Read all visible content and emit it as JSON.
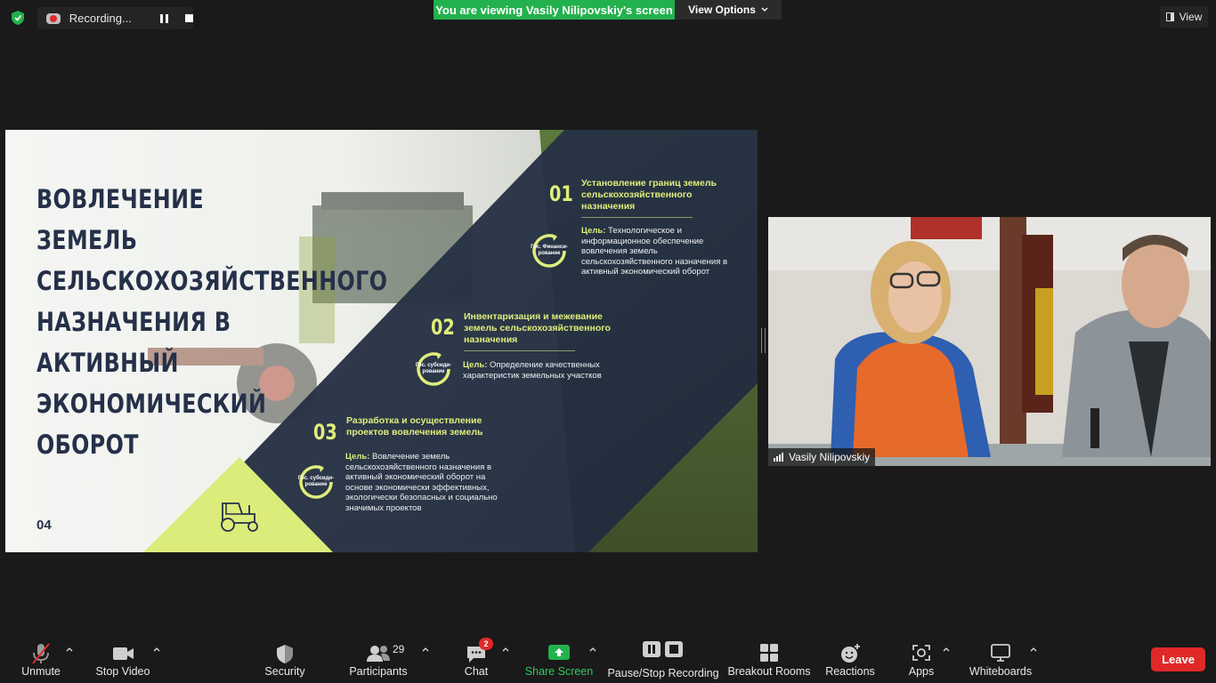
{
  "top_bar": {
    "recording_label": "Recording...",
    "viewing_banner": "You are viewing Vasily Nilipovskiy's screen",
    "view_options_label": "View Options",
    "view_label": "View"
  },
  "slide": {
    "title": "Вовлечение земель сельскохозяйственного назначения в активный экономический оборот",
    "page_number": "04",
    "items": [
      {
        "num": "01",
        "heading": "Установление границ земель сельскохозяйственного назначения",
        "goal_label": "Цель:",
        "goal_text": " Технологическое и информационное обеспечение вовлечения земель сельскохозяйственного назначения в активный экономический оборот",
        "circle_label": "Гос. Финанси-рование"
      },
      {
        "num": "02",
        "heading": "Инвентаризация и межевание земель сельскохозяйственного назначения",
        "goal_label": "Цель:",
        "goal_text": " Определение качественных характеристик земельных участков",
        "circle_label": "Гос. субсиди-рование"
      },
      {
        "num": "03",
        "heading": "Разработка и осуществление проектов вовлечения земель",
        "goal_label": "Цель:",
        "goal_text": " Вовлечение земель сельскохозяйственного назначения в активный экономический оборот на основе экономически эффективных, экологически безопасных и социально значимых проектов",
        "circle_label": "Гос. субсиди-рование"
      }
    ]
  },
  "video": {
    "participant_name": "Vasily Nilipovskiy"
  },
  "toolbar": {
    "unmute": "Unmute",
    "stop_video": "Stop Video",
    "security": "Security",
    "participants": "Participants",
    "participants_count": "29",
    "chat": "Chat",
    "chat_badge": "2",
    "share_screen": "Share Screen",
    "pause_stop_recording": "Pause/Stop Recording",
    "breakout_rooms": "Breakout Rooms",
    "reactions": "Reactions",
    "apps": "Apps",
    "whiteboards": "Whiteboards",
    "leave": "Leave"
  },
  "colors": {
    "banner_green": "#23b14d",
    "share_green": "#23b14d",
    "leave_red": "#e02828",
    "slide_navy": "#253049",
    "slide_accent": "#dfee7c"
  }
}
